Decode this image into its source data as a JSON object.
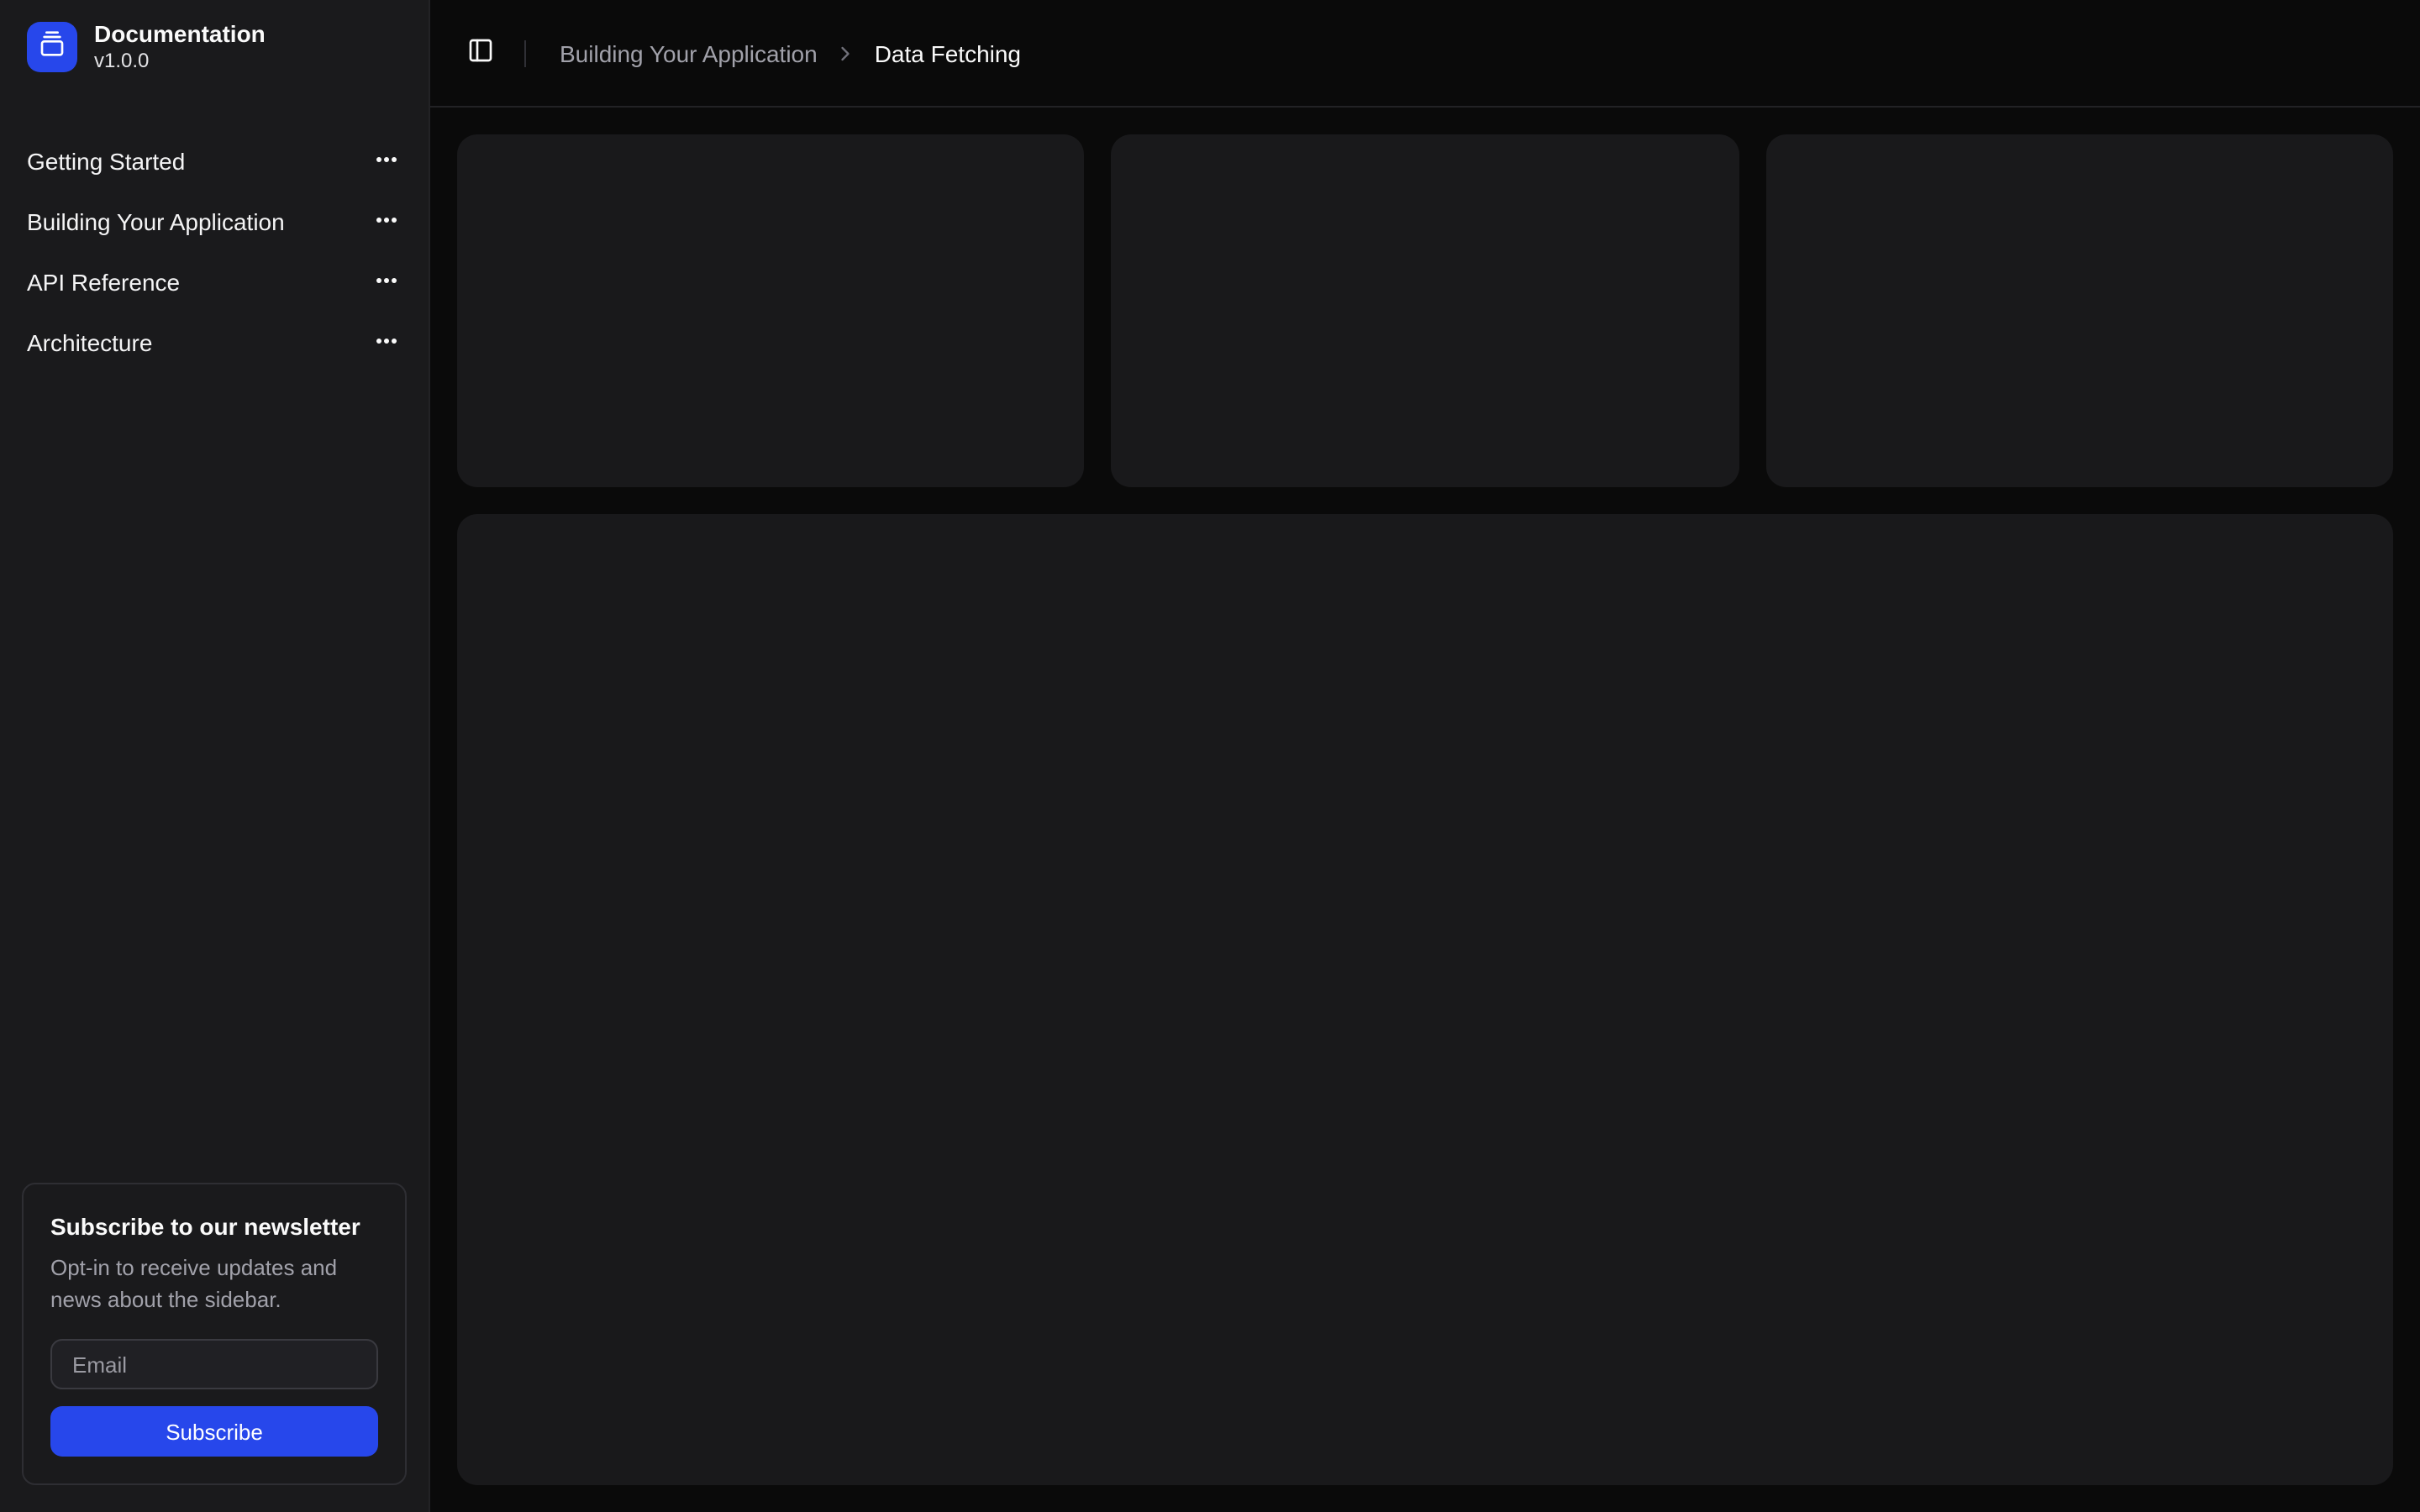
{
  "app": {
    "name": "Documentation",
    "version": "v1.0.0"
  },
  "colors": {
    "accent": "#2747eb",
    "background": "#0a0a0a",
    "sidebar": "#1a1a1c",
    "panel": "#19191b",
    "border": "#27272a",
    "muted_text": "#a1a1aa",
    "text": "#fafafa"
  },
  "sidebar": {
    "items": [
      {
        "label": "Getting Started"
      },
      {
        "label": "Building Your Application"
      },
      {
        "label": "API Reference"
      },
      {
        "label": "Architecture"
      }
    ],
    "newsletter": {
      "title": "Subscribe to our newsletter",
      "body": "Opt-in to receive updates and news about the sidebar.",
      "email_placeholder": "Email",
      "email_value": "",
      "subscribe_label": "Subscribe"
    }
  },
  "header": {
    "breadcrumb": [
      {
        "label": "Building Your Application"
      },
      {
        "label": "Data Fetching"
      }
    ]
  },
  "icons": {
    "logo": "gallery-vertical-end",
    "menu_action": "ellipsis",
    "sidebar_toggle": "panel-left",
    "breadcrumb_separator": "chevron-right"
  }
}
